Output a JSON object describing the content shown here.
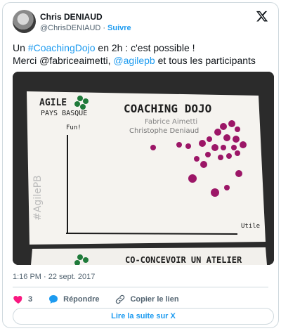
{
  "author": {
    "name": "Chris DENIAUD",
    "handle": "@ChrisDENIAUD",
    "separator": "·",
    "follow_label": "Suivre"
  },
  "tweet": {
    "line1_pre": "Un ",
    "hashtag": "#CoachingDojo",
    "line1_post": " en 2h : c'est possible !",
    "line2_pre": "Merci @fabriceaimetti, ",
    "mention": "@agilepb",
    "line2_post": " et tous les participants"
  },
  "photo": {
    "logo_text_1": "AGILE",
    "logo_text_2": "PAYS BASQUE",
    "title": "COACHING DOJO",
    "subtitle_1": "Fabrice Aimetti",
    "subtitle_2": "Christophe Deniaud",
    "y_axis_label": "Fun!",
    "x_axis_label": "Utile",
    "side_hashtag": "#AgilePB",
    "second_sheet_title": "CO-CONCEVOIR UN ATELIER",
    "dot_color": "#9c1667"
  },
  "meta": {
    "time": "1:16 PM · 22 sept. 2017"
  },
  "actions": {
    "like_count": "3",
    "reply_label": "Répondre",
    "copy_label": "Copier le lien"
  },
  "read_more": "Lire la suite sur X",
  "colors": {
    "accent": "#1d9bf0",
    "like": "#f91880",
    "reply": "#1d9bf0"
  }
}
